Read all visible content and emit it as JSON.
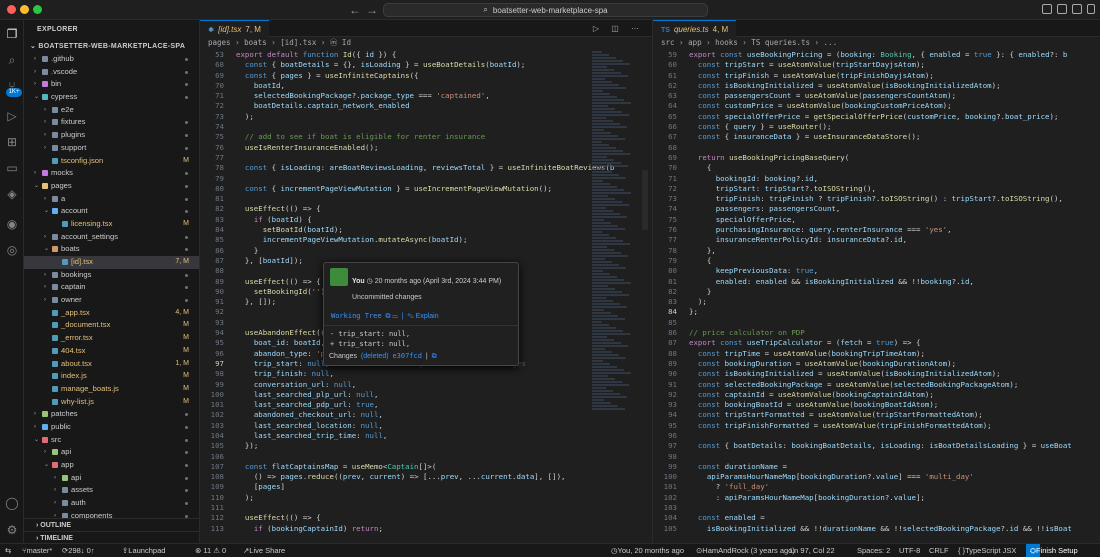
{
  "window": {
    "title": "boatsetter-web-marketplace-spa"
  },
  "explorer": {
    "header": "EXPLORER",
    "project": "BOATSETTER-WEB-MARKETPLACE-SPA",
    "outline": "OUTLINE",
    "timeline": "TIMELINE",
    "items": [
      {
        "label": ".github",
        "type": "folder",
        "open": false,
        "depth": 0,
        "status": "",
        "dot": true
      },
      {
        "label": ".vscode",
        "type": "folder",
        "open": false,
        "depth": 0,
        "status": "",
        "dot": true
      },
      {
        "label": "bin",
        "type": "folder",
        "open": false,
        "depth": 0,
        "status": "",
        "dot": true
      },
      {
        "label": "cypress",
        "type": "folder",
        "open": true,
        "depth": 0,
        "status": "",
        "dot": true
      },
      {
        "label": "e2e",
        "type": "folder",
        "open": false,
        "depth": 1,
        "status": "",
        "dot": false
      },
      {
        "label": "fixtures",
        "type": "folder",
        "open": false,
        "depth": 1,
        "status": "",
        "dot": true
      },
      {
        "label": "plugins",
        "type": "folder",
        "open": false,
        "depth": 1,
        "status": "",
        "dot": true
      },
      {
        "label": "support",
        "type": "folder",
        "open": false,
        "depth": 1,
        "status": "",
        "dot": true
      },
      {
        "label": "tsconfig.json",
        "type": "file",
        "open": false,
        "depth": 1,
        "status": "M",
        "dot": false
      },
      {
        "label": "mocks",
        "type": "folder",
        "open": false,
        "depth": 0,
        "status": "",
        "dot": true
      },
      {
        "label": "pages",
        "type": "folder",
        "open": true,
        "depth": 0,
        "status": "",
        "dot": true
      },
      {
        "label": "a",
        "type": "folder",
        "open": false,
        "depth": 1,
        "status": "",
        "dot": true
      },
      {
        "label": "account",
        "type": "folder",
        "open": true,
        "depth": 1,
        "status": "",
        "dot": true
      },
      {
        "label": "licensing.tsx",
        "type": "file",
        "open": false,
        "depth": 2,
        "status": "M",
        "dot": false
      },
      {
        "label": "account_settings",
        "type": "folder",
        "open": false,
        "depth": 1,
        "status": "",
        "dot": true
      },
      {
        "label": "boats",
        "type": "folder",
        "open": true,
        "depth": 1,
        "status": "",
        "dot": true
      },
      {
        "label": "[id].tsx",
        "type": "file",
        "open": false,
        "depth": 2,
        "status": "7, M",
        "dot": false,
        "selected": true
      },
      {
        "label": "bookings",
        "type": "folder",
        "open": false,
        "depth": 1,
        "status": "",
        "dot": true
      },
      {
        "label": "captain",
        "type": "folder",
        "open": false,
        "depth": 1,
        "status": "",
        "dot": true
      },
      {
        "label": "owner",
        "type": "folder",
        "open": false,
        "depth": 1,
        "status": "",
        "dot": true
      },
      {
        "label": "_app.tsx",
        "type": "file",
        "open": false,
        "depth": 1,
        "status": "4, M",
        "dot": false
      },
      {
        "label": "_document.tsx",
        "type": "file",
        "open": false,
        "depth": 1,
        "status": "M",
        "dot": false
      },
      {
        "label": "_error.tsx",
        "type": "file",
        "open": false,
        "depth": 1,
        "status": "M",
        "dot": false
      },
      {
        "label": "404.tsx",
        "type": "file",
        "open": false,
        "depth": 1,
        "status": "M",
        "dot": false
      },
      {
        "label": "about.tsx",
        "type": "file",
        "open": false,
        "depth": 1,
        "status": "1, M",
        "dot": false
      },
      {
        "label": "index.js",
        "type": "file",
        "open": false,
        "depth": 1,
        "status": "M",
        "dot": false
      },
      {
        "label": "manage_boats.js",
        "type": "file",
        "open": false,
        "depth": 1,
        "status": "M",
        "dot": false
      },
      {
        "label": "why-list.js",
        "type": "file",
        "open": false,
        "depth": 1,
        "status": "M",
        "dot": false
      },
      {
        "label": "patches",
        "type": "folder",
        "open": false,
        "depth": 0,
        "status": "",
        "dot": true
      },
      {
        "label": "public",
        "type": "folder",
        "open": false,
        "depth": 0,
        "status": "",
        "dot": true
      },
      {
        "label": "src",
        "type": "folder",
        "open": true,
        "depth": 0,
        "status": "",
        "dot": true
      },
      {
        "label": "api",
        "type": "folder",
        "open": false,
        "depth": 1,
        "status": "",
        "dot": true
      },
      {
        "label": "app",
        "type": "folder",
        "open": true,
        "depth": 1,
        "status": "",
        "dot": true
      },
      {
        "label": "api",
        "type": "folder",
        "open": false,
        "depth": 2,
        "status": "",
        "dot": true
      },
      {
        "label": "assets",
        "type": "folder",
        "open": false,
        "depth": 2,
        "status": "",
        "dot": true
      },
      {
        "label": "auth",
        "type": "folder",
        "open": false,
        "depth": 2,
        "status": "",
        "dot": true
      },
      {
        "label": "components",
        "type": "folder",
        "open": false,
        "depth": 2,
        "status": "",
        "dot": true
      }
    ]
  },
  "activity": {
    "badge": "1K+"
  },
  "left_editor": {
    "tab": "[id].tsx",
    "tab_status": "7, M",
    "breadcrumb": "pages › boats › [id].tsx › ⓜ Id",
    "lines": [
      {
        "n": "53",
        "t": "export default function Id({ id }) {"
      },
      {
        "n": "68",
        "t": "  const { boatDetails = {}, isLoading } = useBoatDetails(boatId);"
      },
      {
        "n": "69",
        "t": "  const { pages } = useInfiniteCaptains({"
      },
      {
        "n": "70",
        "t": "    boatId,"
      },
      {
        "n": "71",
        "t": "    selectedBookingPackage?.package_type === 'captained',"
      },
      {
        "n": "72",
        "t": "    boatDetails.captain_network_enabled"
      },
      {
        "n": "73",
        "t": "  );"
      },
      {
        "n": "74",
        "t": ""
      },
      {
        "n": "75",
        "t": "  // add to see if boat is eligible for renter insurance"
      },
      {
        "n": "76",
        "t": "  useIsRenterInsuranceEnabled();"
      },
      {
        "n": "77",
        "t": ""
      },
      {
        "n": "78",
        "t": "  const { isLoading: areBoatReviewsLoading, reviewsTotal } = useInfiniteBoatReviews(b"
      },
      {
        "n": "79",
        "t": ""
      },
      {
        "n": "80",
        "t": "  const { incrementPageViewMutation } = useIncrementPageViewMutation();"
      },
      {
        "n": "81",
        "t": ""
      },
      {
        "n": "82",
        "t": "  useEffect(() => {"
      },
      {
        "n": "83",
        "t": "    if (boatId) {"
      },
      {
        "n": "84",
        "t": "      setBoatId(boatId);"
      },
      {
        "n": "85",
        "t": "      incrementPageViewMutation.mutateAsync(boatId);"
      },
      {
        "n": "86",
        "t": "    }"
      },
      {
        "n": "87",
        "t": "  }, [boatId]);"
      },
      {
        "n": "88",
        "t": ""
      },
      {
        "n": "89",
        "t": "  useEffect(() => {"
      },
      {
        "n": "90",
        "t": "    setBookingId('');"
      },
      {
        "n": "91",
        "t": "  }, []);"
      },
      {
        "n": "92",
        "t": ""
      },
      {
        "n": "93",
        "t": ""
      },
      {
        "n": "94",
        "t": "  useAbandonEffect({"
      },
      {
        "n": "95",
        "t": "    boat_id: boatId,"
      },
      {
        "n": "96",
        "t": "    abandon_type: 'pd"
      },
      {
        "n": "97",
        "t": "    trip_start: null,"
      },
      {
        "n": "98",
        "t": "    trip_finish: null,"
      },
      {
        "n": "99",
        "t": "    conversation_url: null,"
      },
      {
        "n": "100",
        "t": "    last_searched_plp_url: null,"
      },
      {
        "n": "101",
        "t": "    last_searched_pdp_url: true,"
      },
      {
        "n": "102",
        "t": "    abandoned_checkout_url: null,"
      },
      {
        "n": "103",
        "t": "    last_searched_location: null,"
      },
      {
        "n": "104",
        "t": "    last_searched_trip_time: null,"
      },
      {
        "n": "105",
        "t": "  });"
      },
      {
        "n": "106",
        "t": ""
      },
      {
        "n": "107",
        "t": "  const flatCaptainsMap = useMemo<Captain[]>("
      },
      {
        "n": "108",
        "t": "    () => pages.reduce((prev, current) => [...prev, ...current.data], []),"
      },
      {
        "n": "109",
        "t": "    [pages]"
      },
      {
        "n": "110",
        "t": "  );"
      },
      {
        "n": "111",
        "t": ""
      },
      {
        "n": "112",
        "t": "  useEffect(() => {"
      },
      {
        "n": "113",
        "t": "    if (bookingCaptainId) return;"
      }
    ],
    "ghost_text": "You, 20 months ago • Uncommitted changes"
  },
  "blame_popup": {
    "author": "You",
    "time": "20 months ago (April 3rd, 2024 3:44 PM)",
    "message": "Uncommitted changes",
    "working_tree": "Working Tree",
    "explain": "Explain",
    "diff_minus": "- trip_start: null,",
    "diff_plus": "+ trip_start: null,",
    "changes": "Changes",
    "deleted": "(deleted)",
    "hash": "e307fcd"
  },
  "right_editor": {
    "tab": "queries.ts",
    "tab_status": "4, M",
    "breadcrumb": "src › app › hooks › TS queries.ts › ...",
    "lines": [
      {
        "n": "59",
        "t": "export const useBookingPricing = (booking: Booking, { enabled = true }: { enabled?: b"
      },
      {
        "n": "60",
        "t": "  const tripStart = useAtomValue(tripStartDayjsAtom);"
      },
      {
        "n": "61",
        "t": "  const tripFinish = useAtomValue(tripFinishDayjsAtom);"
      },
      {
        "n": "62",
        "t": "  const isBookingInitialized = useAtomValue(isBookingInitializedAtom);"
      },
      {
        "n": "63",
        "t": "  const passengersCount = useAtomValue(passengersCountAtom);"
      },
      {
        "n": "64",
        "t": "  const customPrice = useAtomValue(bookingCustomPriceAtom);"
      },
      {
        "n": "65",
        "t": "  const specialOfferPrice = getSpecialOfferPrice(customPrice, booking?.boat_price);"
      },
      {
        "n": "66",
        "t": "  const { query } = useRouter();"
      },
      {
        "n": "67",
        "t": "  const { insuranceData } = useInsuranceDataStore();"
      },
      {
        "n": "68",
        "t": ""
      },
      {
        "n": "69",
        "t": "  return useBookingPricingBaseQuery("
      },
      {
        "n": "70",
        "t": "    {"
      },
      {
        "n": "71",
        "t": "      bookingId: booking?.id,"
      },
      {
        "n": "72",
        "t": "      tripStart: tripStart?.toISOString(),"
      },
      {
        "n": "73",
        "t": "      tripFinish: tripFinish ? tripFinish?.toISOString() : tripStart?.toISOString(),"
      },
      {
        "n": "74",
        "t": "      passengers: passengersCount,"
      },
      {
        "n": "75",
        "t": "      specialOfferPrice,"
      },
      {
        "n": "76",
        "t": "      purchasingInsurance: query.renterInsurance === 'yes',"
      },
      {
        "n": "77",
        "t": "      insuranceRenterPolicyId: insuranceData?.id,"
      },
      {
        "n": "78",
        "t": "    },"
      },
      {
        "n": "79",
        "t": "    {"
      },
      {
        "n": "80",
        "t": "      keepPreviousData: true,"
      },
      {
        "n": "81",
        "t": "      enabled: enabled && isBookingInitialized && !!booking?.id,"
      },
      {
        "n": "82",
        "t": "    }"
      },
      {
        "n": "83",
        "t": "  );"
      },
      {
        "n": "84",
        "t": "};"
      },
      {
        "n": "85",
        "t": ""
      },
      {
        "n": "86",
        "t": "// price calculator on PDP"
      },
      {
        "n": "87",
        "t": "export const useTripCalculator = (fetch = true) => {"
      },
      {
        "n": "88",
        "t": "  const tripTime = useAtomValue(bookingTripTimeAtom);"
      },
      {
        "n": "89",
        "t": "  const bookingDuration = useAtomValue(bookingDurationAtom);"
      },
      {
        "n": "90",
        "t": "  const isBookingInitialized = useAtomValue(isBookingInitializedAtom);"
      },
      {
        "n": "91",
        "t": "  const selectedBookingPackage = useAtomValue(selectedBookingPackageAtom);"
      },
      {
        "n": "92",
        "t": "  const captainId = useAtomValue(bookingCaptainIdAtom);"
      },
      {
        "n": "93",
        "t": "  const bookingBoatId = useAtomValue(bookingBoatIdAtom);"
      },
      {
        "n": "94",
        "t": "  const tripStartFormatted = useAtomValue(tripStartFormattedAtom);"
      },
      {
        "n": "95",
        "t": "  const tripFinishFormatted = useAtomValue(tripFinishFormattedAtom);"
      },
      {
        "n": "96",
        "t": ""
      },
      {
        "n": "97",
        "t": "  const { boatDetails: bookingBoatDetails, isLoading: isBoatDetailsLoading } = useBoat"
      },
      {
        "n": "98",
        "t": ""
      },
      {
        "n": "99",
        "t": "  const durationName ="
      },
      {
        "n": "100",
        "t": "    apiParamsHourNameMap[bookingDuration?.value] === 'multi_day'"
      },
      {
        "n": "101",
        "t": "      ? 'full_day'"
      },
      {
        "n": "102",
        "t": "      : apiParamsHourNameMap[bookingDuration?.value];"
      },
      {
        "n": "103",
        "t": ""
      },
      {
        "n": "104",
        "t": "  const enabled ="
      },
      {
        "n": "105",
        "t": "    isBookingInitialized && !!durationName && !!selectedBookingPackage?.id && !!isBoat"
      }
    ]
  },
  "status": {
    "branch": "master*",
    "sync": "298↓ 0↑",
    "launchpad": "Launchpad",
    "problems": "⊗ 11 ⚠ 0",
    "live_share": "Live Share",
    "blame": "You, 20 months ago",
    "remote": "HamAndRock (3 years ago)",
    "position": "Ln 97, Col 22",
    "spaces": "Spaces: 2",
    "encoding": "UTF-8",
    "eol": "CRLF",
    "language": "TypeScript JSX",
    "finish": "Finish Setup"
  }
}
